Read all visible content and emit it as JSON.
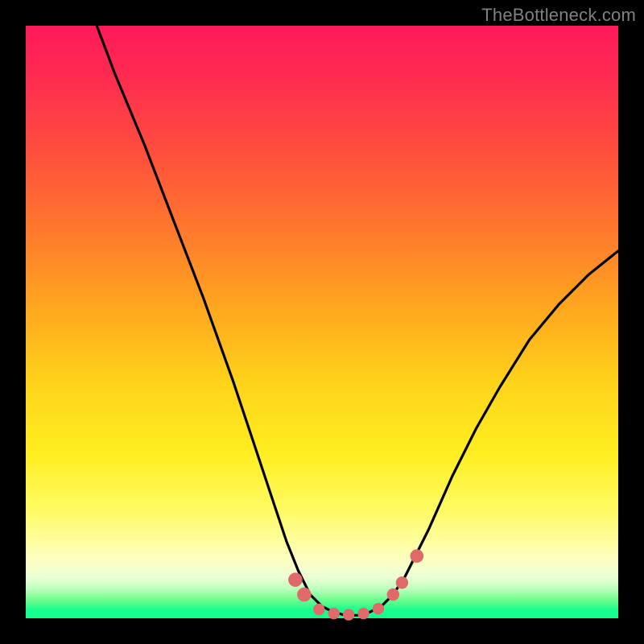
{
  "watermark": "TheBottleneck.com",
  "chart_data": {
    "type": "line",
    "title": "",
    "xlabel": "",
    "ylabel": "",
    "xlim": [
      0,
      100
    ],
    "ylim": [
      0,
      100
    ],
    "series": [
      {
        "name": "curve",
        "x": [
          12,
          15,
          20,
          25,
          30,
          35,
          38,
          40,
          42,
          44,
          46,
          48,
          50,
          52,
          54,
          56,
          58,
          60,
          62,
          64,
          66,
          68,
          72,
          76,
          80,
          85,
          90,
          95,
          100
        ],
        "y": [
          100,
          92,
          80,
          67,
          54,
          40,
          31,
          25,
          19,
          13,
          8,
          4,
          2,
          1,
          0.5,
          0.5,
          1,
          2,
          4,
          7,
          11,
          15,
          24,
          32,
          39,
          47,
          53,
          58,
          62
        ]
      }
    ],
    "markers": [
      {
        "x": 45.5,
        "y": 6.5,
        "r": 1.6
      },
      {
        "x": 47.0,
        "y": 4.0,
        "r": 1.6
      },
      {
        "x": 49.5,
        "y": 1.5,
        "r": 1.3
      },
      {
        "x": 52.0,
        "y": 0.8,
        "r": 1.3
      },
      {
        "x": 54.5,
        "y": 0.6,
        "r": 1.3
      },
      {
        "x": 57.0,
        "y": 0.8,
        "r": 1.3
      },
      {
        "x": 59.5,
        "y": 1.6,
        "r": 1.3
      },
      {
        "x": 62.0,
        "y": 4.0,
        "r": 1.4
      },
      {
        "x": 63.5,
        "y": 6.0,
        "r": 1.4
      },
      {
        "x": 66.0,
        "y": 10.5,
        "r": 1.5
      }
    ],
    "marker_color": "#e06a6a",
    "curve_color": "#000000"
  }
}
